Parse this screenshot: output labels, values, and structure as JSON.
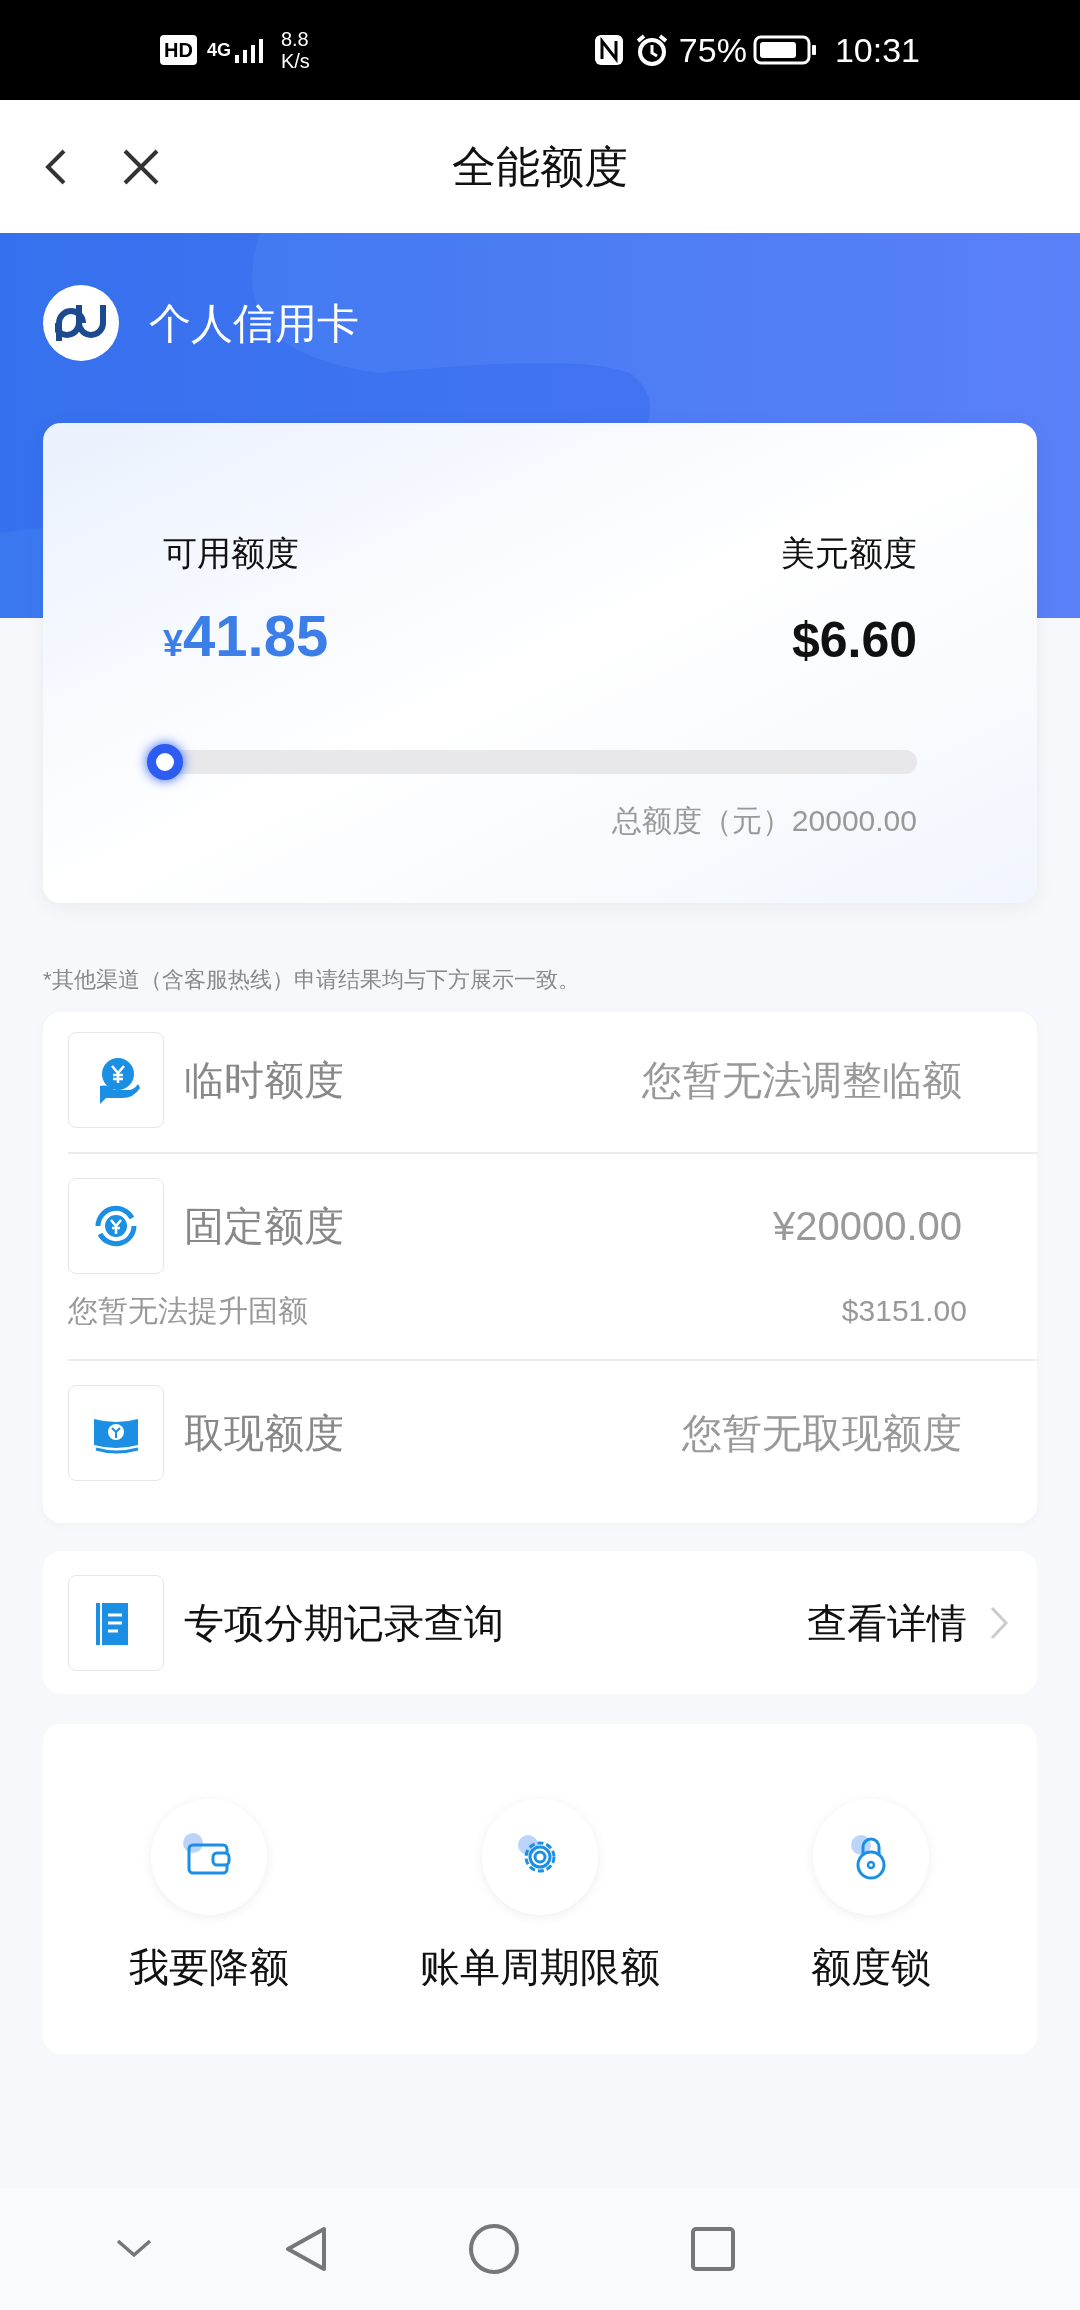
{
  "status_bar": {
    "hd_badge": "HD",
    "network_type": "4G",
    "speed": "8.8",
    "speed_unit": "K/s",
    "battery": "75%",
    "time": "10:31"
  },
  "header": {
    "title": "全能额度"
  },
  "card_title": "个人信用卡",
  "limit_card": {
    "available_label": "可用额度",
    "available_currency": "¥",
    "available_amount": "41.85",
    "usd_label": "美元额度",
    "usd_value": "$6.60",
    "level": 0.002,
    "total": "总额度（元）20000.00"
  },
  "note": "*其他渠道（含客服热线）申请结果均与下方展示一致。",
  "limits": [
    {
      "kind": "plain",
      "label": "临时额度",
      "value": "您暂无法调整临额"
    },
    {
      "kind": "detail",
      "label": "固定额度",
      "value": "¥20000.00",
      "sub_label": "您暂无法提升固额",
      "sub_value": "$3151.00"
    },
    {
      "kind": "plain",
      "label": "取现额度",
      "value": "您暂无取现额度"
    }
  ],
  "installment": {
    "label": "专项分期记录查询",
    "action": "查看详情"
  },
  "actions": [
    {
      "label": "我要降额"
    },
    {
      "label": "账单周期限额"
    },
    {
      "label": "额度锁"
    }
  ]
}
